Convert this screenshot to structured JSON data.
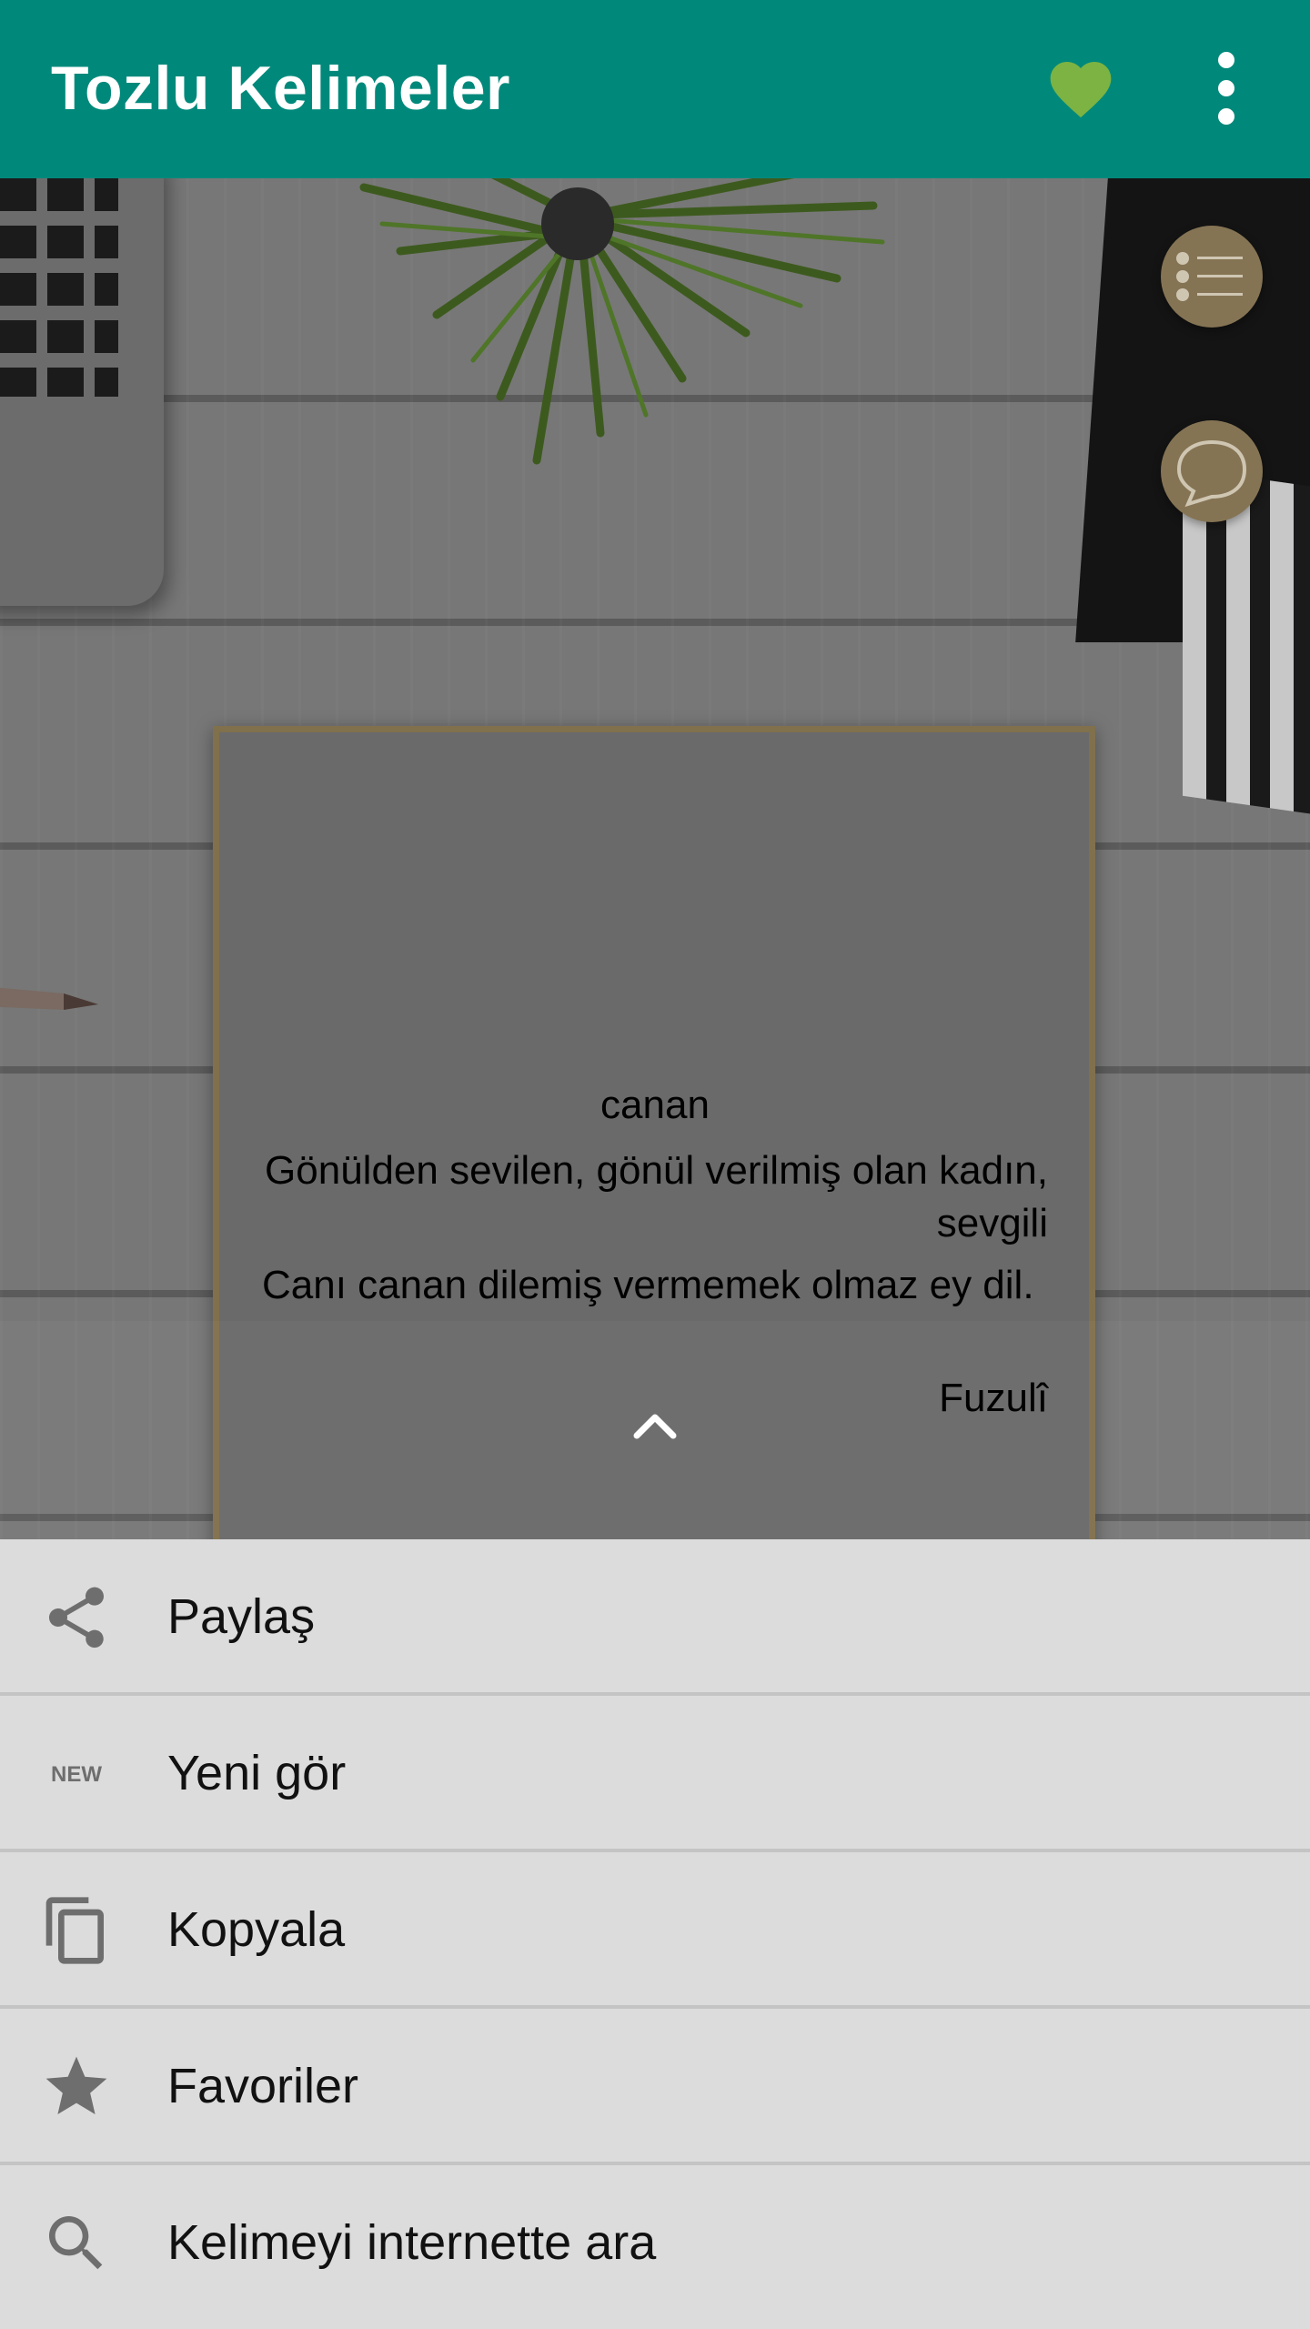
{
  "app_bar": {
    "title": "Tozlu Kelimeler",
    "favorite_icon": "heart-icon",
    "favorite_color": "#7cb342",
    "menu_icon": "more-vert-icon",
    "background": "#00897b"
  },
  "side_actions": [
    {
      "icon": "list-icon"
    },
    {
      "icon": "chat-bubble-icon"
    }
  ],
  "card": {
    "word": "canan",
    "meaning": "Gönülden sevilen, gönül verilmiş olan kadın, sevgili",
    "example": "Canı canan dilemiş vermemek olmaz ey dil.",
    "author": "Fuzulî",
    "expand_icon": "chevron-up-icon"
  },
  "bottom_sheet": {
    "items": [
      {
        "label": "Paylaş",
        "icon": "share-icon"
      },
      {
        "label": "Yeni gör",
        "icon": "new-icon"
      },
      {
        "label": "Kopyala",
        "icon": "copy-icon"
      },
      {
        "label": "Favoriler",
        "icon": "star-icon"
      },
      {
        "label": "Kelimeyi internette ara",
        "icon": "search-icon"
      }
    ]
  }
}
